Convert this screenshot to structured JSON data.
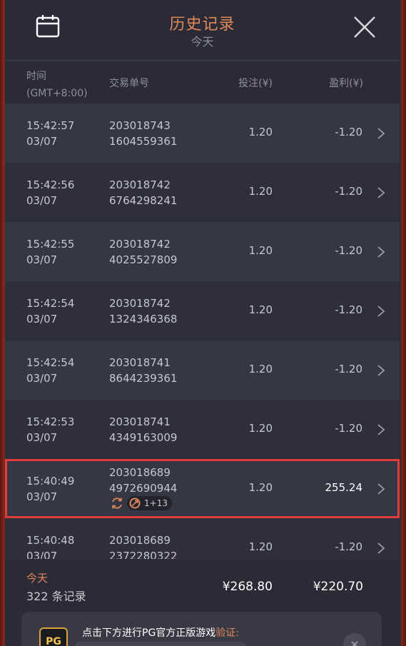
{
  "header": {
    "title": "历史记录",
    "subtitle": "今天"
  },
  "columns": {
    "time_line1": "时间",
    "time_line2": "(GMT+8:00)",
    "order": "交易单号",
    "bet": "投注(¥)",
    "profit": "盈利(¥)"
  },
  "rows": [
    {
      "time": "15:42:57",
      "date": "03/07",
      "order1": "203018743",
      "order2": "1604559361",
      "bet": "1.20",
      "profit": "-1.20"
    },
    {
      "time": "15:42:56",
      "date": "03/07",
      "order1": "203018742",
      "order2": "6764298241",
      "bet": "1.20",
      "profit": "-1.20"
    },
    {
      "time": "15:42:55",
      "date": "03/07",
      "order1": "203018742",
      "order2": "4025527809",
      "bet": "1.20",
      "profit": "-1.20"
    },
    {
      "time": "15:42:54",
      "date": "03/07",
      "order1": "203018742",
      "order2": "1324346368",
      "bet": "1.20",
      "profit": "-1.20"
    },
    {
      "time": "15:42:54",
      "date": "03/07",
      "order1": "203018741",
      "order2": "8644239361",
      "bet": "1.20",
      "profit": "-1.20"
    },
    {
      "time": "15:42:53",
      "date": "03/07",
      "order1": "203018741",
      "order2": "4349163009",
      "bet": "1.20",
      "profit": "-1.20"
    },
    {
      "time": "15:40:49",
      "date": "03/07",
      "order1": "203018689",
      "order2": "4972690944",
      "bet": "1.20",
      "profit": "255.24",
      "badge": "1+13"
    },
    {
      "time": "15:40:48",
      "date": "03/07",
      "order1": "203018689",
      "order2": "2372280322",
      "bet": "1.20",
      "profit": "-1.20"
    }
  ],
  "summary": {
    "today": "今天",
    "count": "322 条记录",
    "total_bet": "¥268.80",
    "total_profit": "¥220.70"
  },
  "verify": {
    "logo": "PG",
    "text": "点击下方进行PG官方正版游戏",
    "link": "验证:"
  },
  "colors": {
    "accent": "#e0875a",
    "highlight_border": "#e23b3b",
    "panel_bg": "#2b2c37"
  },
  "icons": {
    "calendar": "calendar-icon",
    "close": "close-icon",
    "chevron": "chevron-right-icon",
    "refresh": "refresh-icon",
    "free-spin": "free-spin-icon"
  }
}
